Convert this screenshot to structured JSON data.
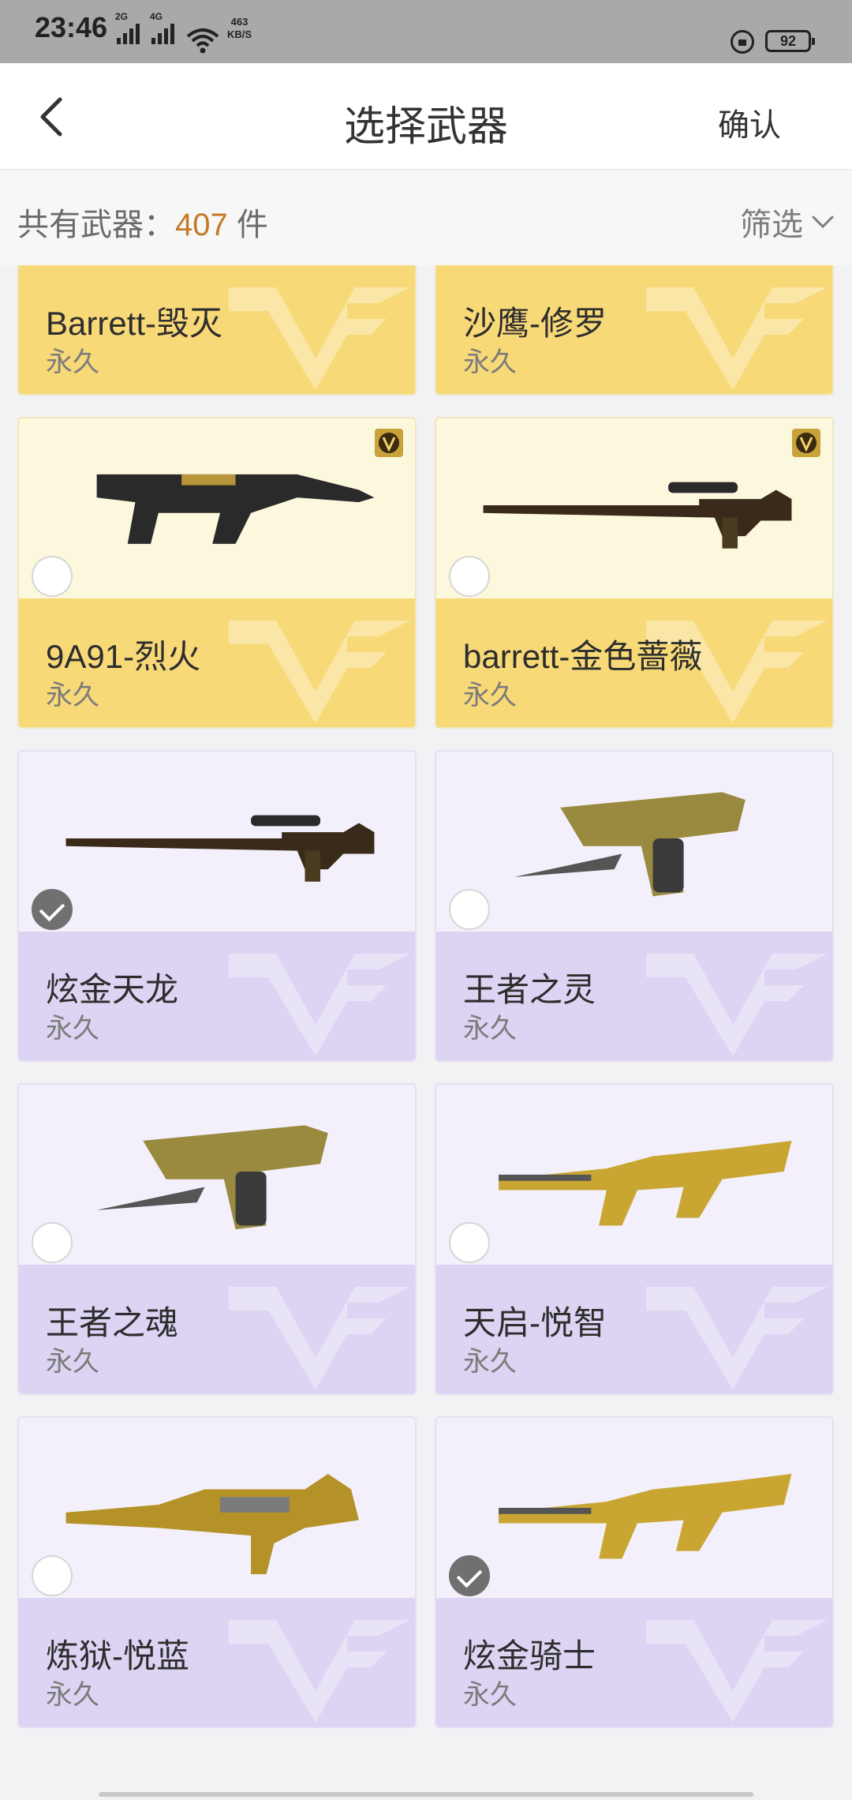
{
  "status_bar": {
    "time": "23:46",
    "net1": "2G",
    "net2": "4G",
    "speed_value": "463",
    "speed_unit": "KB/S",
    "battery": "92"
  },
  "nav": {
    "title": "选择武器",
    "confirm_label": "确认"
  },
  "summary": {
    "label": "共有武器：",
    "count": "407",
    "unit": " 件",
    "filter_label": "筛选"
  },
  "colors": {
    "gold_bg": "#fcf8dd",
    "gold_band": "#f8d978",
    "purple_bg": "#f3f0fb",
    "purple_band": "#ddd4f3",
    "accent_count": "#c47a25"
  },
  "weapons": [
    {
      "name": "Barrett-毁灭",
      "duration": "永久",
      "tier": "gold",
      "selected": false,
      "badge": false,
      "icon": "sniper-rifle-icon"
    },
    {
      "name": "沙鹰-修罗",
      "duration": "永久",
      "tier": "gold",
      "selected": false,
      "badge": false,
      "icon": "pistol-blade-icon"
    },
    {
      "name": "9A91-烈火",
      "duration": "永久",
      "tier": "gold",
      "selected": false,
      "badge": true,
      "icon": "smg-icon"
    },
    {
      "name": "barrett-金色蔷薇",
      "duration": "永久",
      "tier": "gold",
      "selected": false,
      "badge": true,
      "icon": "sniper-rifle-icon"
    },
    {
      "name": "炫金天龙",
      "duration": "永久",
      "tier": "purple",
      "selected": true,
      "badge": false,
      "icon": "sniper-rifle-icon"
    },
    {
      "name": "王者之灵",
      "duration": "永久",
      "tier": "purple",
      "selected": false,
      "badge": false,
      "icon": "pistol-blade-icon"
    },
    {
      "name": "王者之魂",
      "duration": "永久",
      "tier": "purple",
      "selected": false,
      "badge": false,
      "icon": "pistol-blade-icon"
    },
    {
      "name": "天启-悦智",
      "duration": "永久",
      "tier": "purple",
      "selected": false,
      "badge": false,
      "icon": "assault-rifle-icon"
    },
    {
      "name": "炼狱-悦蓝",
      "duration": "永久",
      "tier": "purple",
      "selected": false,
      "badge": false,
      "icon": "machine-gun-icon"
    },
    {
      "name": "炫金骑士",
      "duration": "永久",
      "tier": "purple",
      "selected": true,
      "badge": false,
      "icon": "assault-rifle-icon"
    }
  ]
}
